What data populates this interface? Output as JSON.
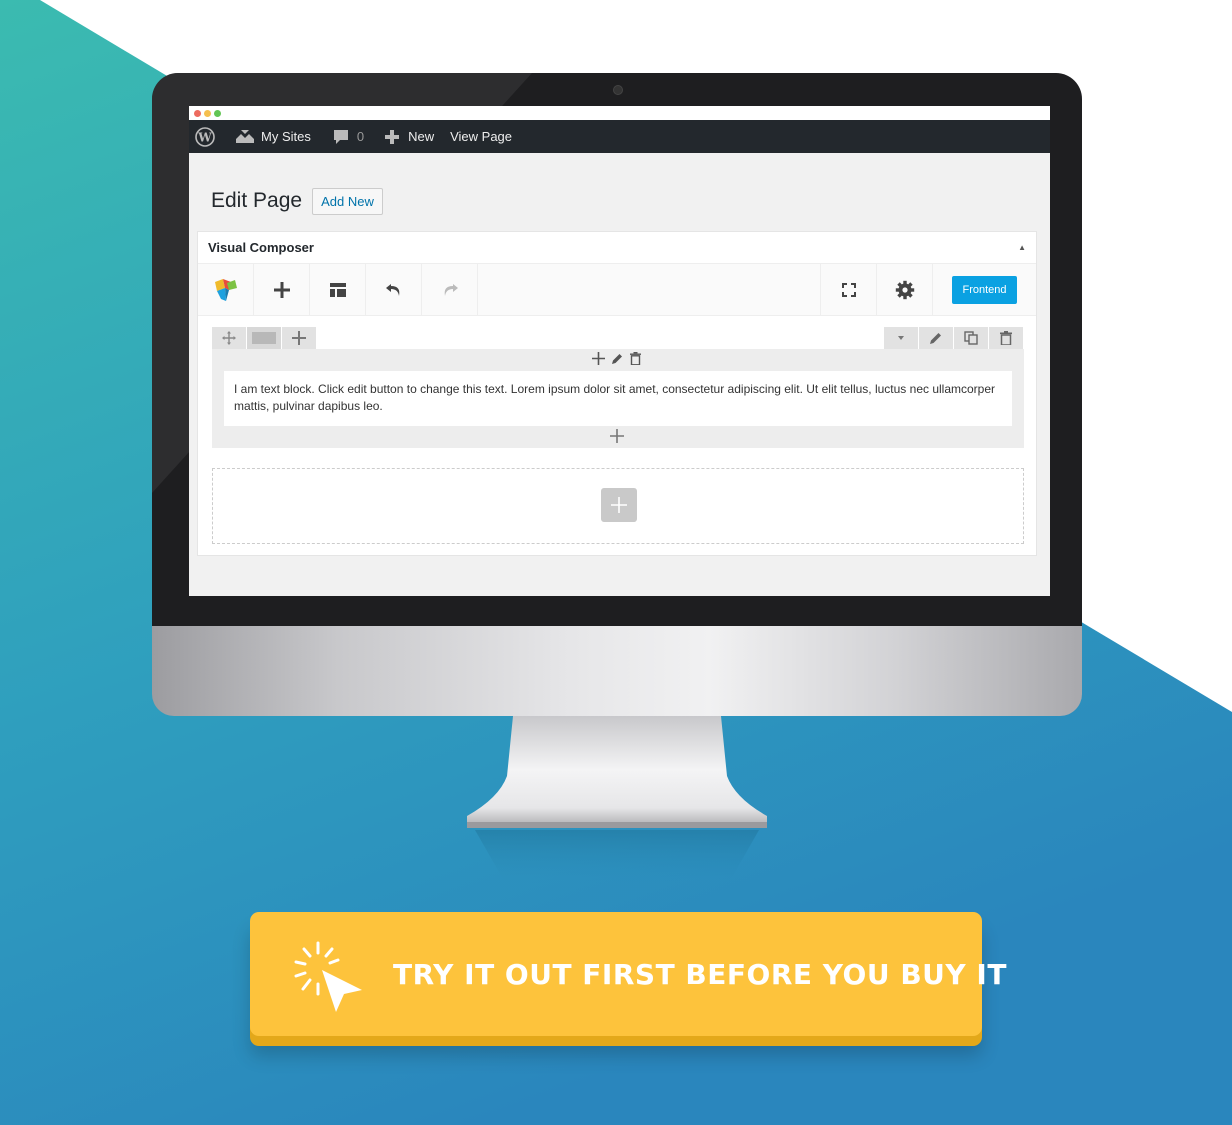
{
  "colors": {
    "teal": "#3bbbb0",
    "blue": "#2b8fbd",
    "cta_yellow": "#fdc33c",
    "frontend_blue": "#0aa1e2",
    "admin_bar": "#23282d"
  },
  "window": {
    "dots": [
      "#ed6b5f",
      "#f5bf4f",
      "#62c554"
    ]
  },
  "admin_bar": {
    "logo": "wordpress-icon",
    "my_sites": "My Sites",
    "comment_count": "0",
    "new": "New",
    "view_page": "View Page"
  },
  "page": {
    "title": "Edit Page",
    "add_new": "Add New"
  },
  "visual_composer": {
    "title": "Visual Composer",
    "frontend_label": "Frontend",
    "toolbar_icons": [
      "vc-logo-icon",
      "plus-icon",
      "layout-icon",
      "undo-icon",
      "redo-icon",
      "fullscreen-icon",
      "gear-icon"
    ],
    "text_block": "I am text block. Click edit button to change this text. Lorem ipsum dolor sit amet, consectetur adipiscing elit. Ut elit tellus, luctus nec ullamcorper mattis, pulvinar dapibus leo."
  },
  "cta": {
    "label": "TRY IT OUT FIRST BEFORE YOU BUY IT",
    "icon": "cursor-click-icon"
  }
}
